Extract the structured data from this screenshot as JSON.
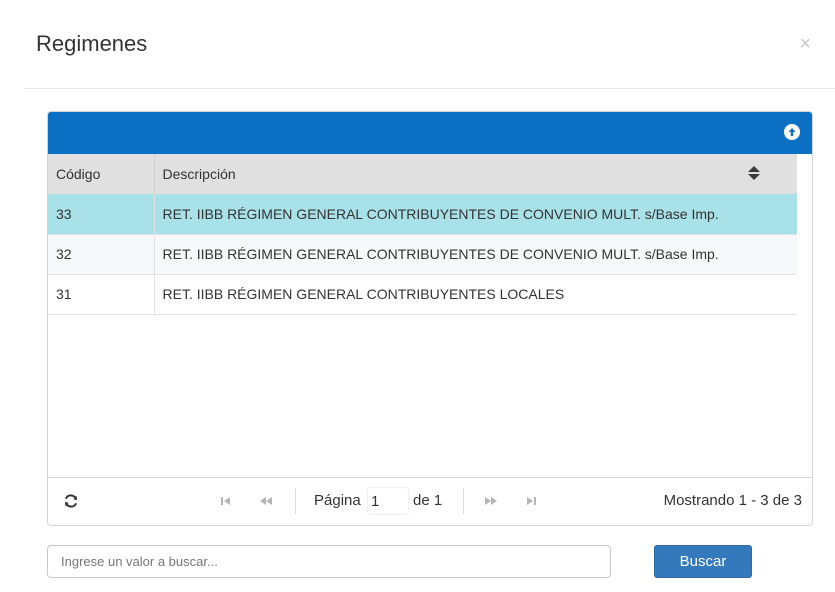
{
  "modal": {
    "title": "Regimenes",
    "close_label": "×"
  },
  "grid": {
    "header_color": "#0b6fc4",
    "selected_row_color": "#a8e2e8",
    "columns": [
      "Código",
      "Descripción"
    ],
    "rows": [
      {
        "codigo": "33",
        "descripcion": "RET. IIBB RÉGIMEN GENERAL CONTRIBUYENTES DE CONVENIO MULT. s/Base Imp.",
        "selected": true
      },
      {
        "codigo": "32",
        "descripcion": "RET. IIBB RÉGIMEN GENERAL CONTRIBUYENTES DE CONVENIO MULT. s/Base Imp.",
        "selected": false
      },
      {
        "codigo": "31",
        "descripcion": "RET. IIBB RÉGIMEN GENERAL CONTRIBUYENTES LOCALES",
        "selected": false
      }
    ]
  },
  "pager": {
    "page_label": "Página",
    "current_page": "1",
    "of_label": "de 1",
    "records_info": "Mostrando 1 - 3 de 3",
    "icons": [
      "refresh-icon",
      "first-page-icon",
      "prev-page-icon",
      "next-page-icon",
      "last-page-icon"
    ]
  },
  "search": {
    "placeholder": "Ingrese un valor a buscar...",
    "value": "",
    "button_label": "Buscar",
    "button_color": "#3579bd"
  }
}
